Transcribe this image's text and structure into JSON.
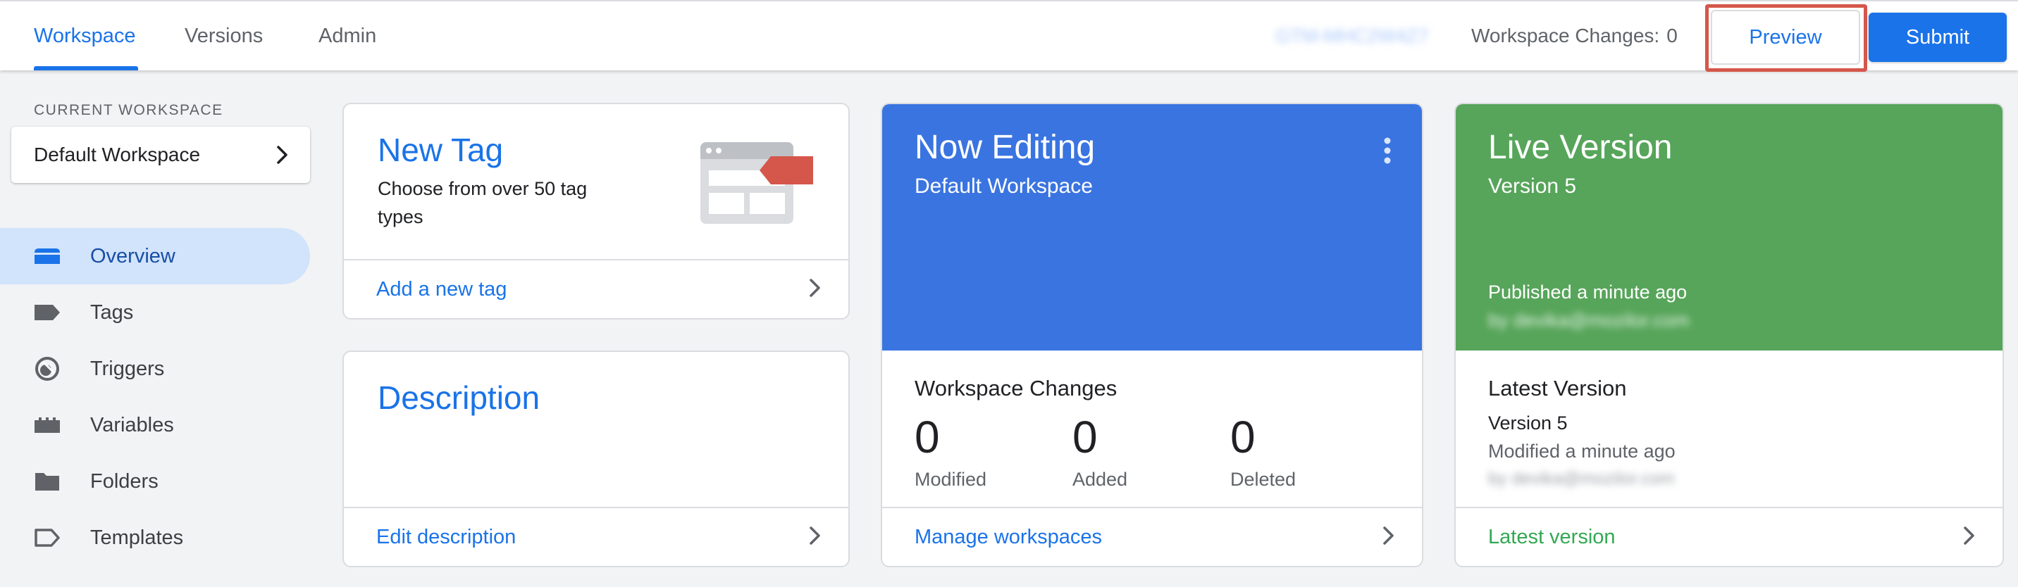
{
  "topbar": {
    "tabs": [
      "Workspace",
      "Versions",
      "Admin"
    ],
    "container_id": "GTM-MHC2W4Z7",
    "workspace_changes_label": "Workspace Changes:",
    "workspace_changes_count": "0",
    "preview_label": "Preview",
    "submit_label": "Submit"
  },
  "sidebar": {
    "current_workspace_label": "CURRENT WORKSPACE",
    "workspace_name": "Default Workspace",
    "items": [
      {
        "label": "Overview",
        "icon": "overview-icon"
      },
      {
        "label": "Tags",
        "icon": "tag-icon"
      },
      {
        "label": "Triggers",
        "icon": "trigger-icon"
      },
      {
        "label": "Variables",
        "icon": "variables-icon"
      },
      {
        "label": "Folders",
        "icon": "folder-icon"
      },
      {
        "label": "Templates",
        "icon": "template-icon"
      }
    ]
  },
  "new_tag_card": {
    "title": "New Tag",
    "subtitle_line1": "Choose from over 50 tag",
    "subtitle_line2": "types",
    "link": "Add a new tag"
  },
  "description_card": {
    "title": "Description",
    "link": "Edit description"
  },
  "now_editing_card": {
    "title": "Now Editing",
    "subtitle": "Default Workspace",
    "section_title": "Workspace Changes",
    "stats": [
      {
        "value": "0",
        "label": "Modified"
      },
      {
        "value": "0",
        "label": "Added"
      },
      {
        "value": "0",
        "label": "Deleted"
      }
    ],
    "link": "Manage workspaces"
  },
  "live_version_card": {
    "title": "Live Version",
    "subtitle": "Version 5",
    "published": "Published a minute ago",
    "published_by": "by devika@mozilor.com",
    "section_title": "Latest Version",
    "version": "Version 5",
    "modified": "Modified a minute ago",
    "modified_by": "by devika@mozilor.com",
    "link": "Latest version"
  },
  "colors": {
    "accent": "#1a73e8",
    "now_editing_bg": "#3a74e0",
    "live_version_bg": "#57a55a",
    "highlight_border": "#d5564b",
    "nav_active_bg": "#d2e3fc"
  }
}
